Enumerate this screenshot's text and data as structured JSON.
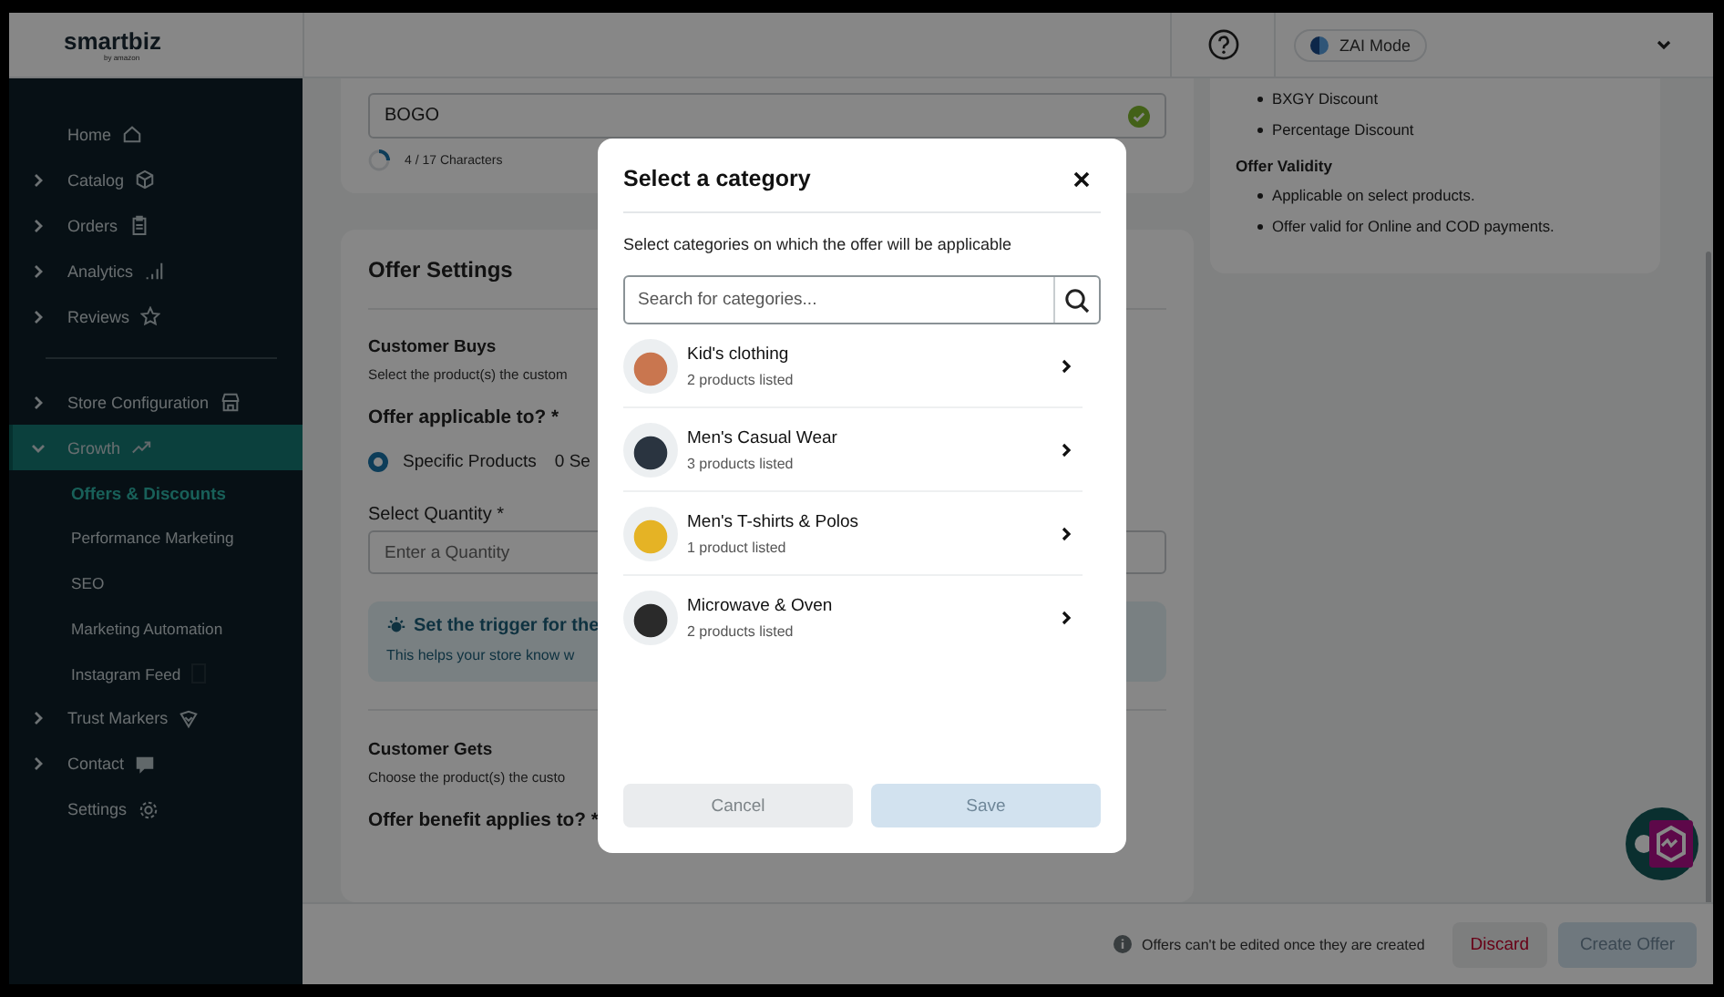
{
  "header": {
    "logo": "smartbiz",
    "logo_sub": "by amazon",
    "mode_button": "ZAI Mode"
  },
  "sidebar": {
    "items": [
      {
        "label": "Home",
        "kind": "link",
        "selected": false
      },
      {
        "label": "Catalog",
        "kind": "group",
        "expanded": false,
        "selected": false
      },
      {
        "label": "Orders",
        "kind": "group",
        "expanded": false,
        "selected": false
      },
      {
        "label": "Analytics",
        "kind": "group",
        "expanded": false,
        "selected": false
      },
      {
        "label": "Reviews",
        "kind": "group",
        "expanded": false,
        "selected": false
      },
      {
        "kind": "divider"
      },
      {
        "label": "Store Configuration",
        "kind": "group",
        "expanded": false,
        "selected": false
      },
      {
        "label": "Growth",
        "kind": "group",
        "expanded": true,
        "selected": true,
        "children": [
          {
            "label": "Offers & Discounts",
            "selected": true
          },
          {
            "label": "Performance Marketing",
            "selected": false
          },
          {
            "label": "SEO",
            "selected": false
          },
          {
            "label": "Marketing Automation",
            "selected": false
          },
          {
            "label": "Instagram Feed",
            "selected": false
          }
        ]
      },
      {
        "label": "Trust Markers",
        "kind": "group",
        "expanded": false,
        "selected": false
      },
      {
        "label": "Contact",
        "kind": "group",
        "expanded": false,
        "selected": false
      },
      {
        "label": "Settings",
        "kind": "link",
        "selected": false
      }
    ]
  },
  "offer_name": {
    "value": "BOGO",
    "valid": true,
    "counter": "4 / 17 Characters"
  },
  "offer_settings": {
    "title": "Offer Settings",
    "customer_buys": {
      "heading": "Customer Buys",
      "text": "Select the product(s) the custom"
    },
    "applicable_label": "Offer applicable to? *",
    "applicable_options": [
      {
        "label": "Specific Products",
        "selected": true,
        "note": "0 Se"
      }
    ],
    "quantity_label": "Select Quantity *",
    "quantity_placeholder": "Enter a Quantity",
    "tip": {
      "title": "Set the trigger for the",
      "text": "This helps your store know w"
    },
    "customer_gets": {
      "heading": "Customer Gets",
      "text": "Choose the product(s) the custo"
    },
    "benefit_label": "Offer benefit applies to? *"
  },
  "info_card": {
    "types": [
      "BXGY Discount",
      "Percentage Discount"
    ],
    "validity_heading": "Offer Validity",
    "validity": [
      "Applicable on select products.",
      "Offer valid for Online and COD payments."
    ]
  },
  "footer": {
    "note": "Offers can't be edited once they are created",
    "buttons": [
      {
        "label": "Discard",
        "kind": "danger",
        "disabled": false
      },
      {
        "label": "Create Offer",
        "kind": "primary",
        "disabled": true
      }
    ]
  },
  "modal": {
    "title": "Select a category",
    "subtitle": "Select categories on which the offer will be applicable",
    "search_placeholder": "Search for categories...",
    "categories": [
      {
        "name": "Kid's clothing",
        "count": "2 products listed"
      },
      {
        "name": "Men's Casual Wear",
        "count": "3 products listed"
      },
      {
        "name": "Men's T-shirts & Polos",
        "count": "1 product listed"
      },
      {
        "name": "Microwave & Oven",
        "count": "2 products listed"
      }
    ],
    "buttons": [
      {
        "label": "Cancel",
        "kind": "secondary",
        "disabled": true
      },
      {
        "label": "Save",
        "kind": "primary",
        "disabled": true
      }
    ]
  }
}
